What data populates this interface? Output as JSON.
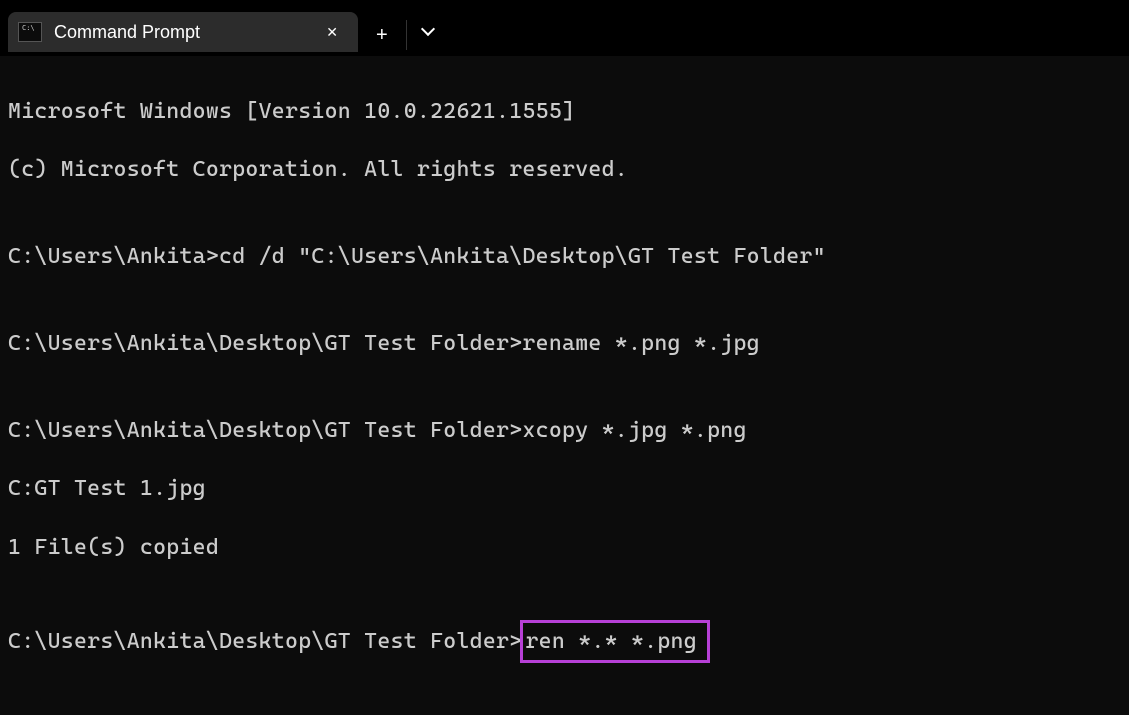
{
  "tab": {
    "title": "Command Prompt",
    "icon_glyph": "C:\\"
  },
  "terminal": {
    "line1": "Microsoft Windows [Version 10.0.22621.1555]",
    "line2": "(c) Microsoft Corporation. All rights reserved.",
    "blank1": "",
    "line3": "C:\\Users\\Ankita>cd /d \"C:\\Users\\Ankita\\Desktop\\GT Test Folder\"",
    "blank2": "",
    "line4": "C:\\Users\\Ankita\\Desktop\\GT Test Folder>rename *.png *.jpg",
    "blank3": "",
    "line5": "C:\\Users\\Ankita\\Desktop\\GT Test Folder>xcopy *.jpg *.png",
    "line6": "C:GT Test 1.jpg",
    "line7": "1 File(s) copied",
    "blank4": "",
    "line8_prefix": "C:\\Users\\Ankita\\Desktop\\GT Test Folder>",
    "line8_highlighted": "ren *.* *.png"
  }
}
